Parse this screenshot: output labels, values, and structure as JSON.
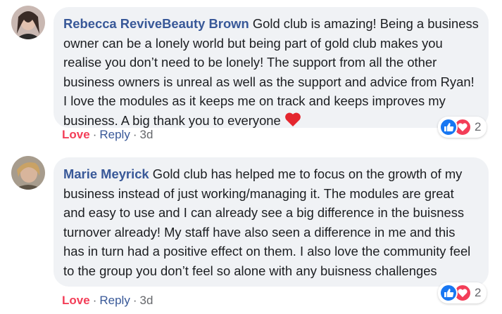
{
  "comments": [
    {
      "author": "Rebecca ReviveBeauty Brown",
      "text": "Gold club is amazing! Being a business owner can be a lonely world but being part of gold club makes you realise you don’t need to be lonely! The support from all the other business owners is unreal as well as the support and advice from Ryan! I love the modules as it keeps me on track and keeps improves my business. A big thank you to everyone",
      "reaction_count": "2",
      "reaction_label": "Love",
      "reply_label": "Reply",
      "time": "3d"
    },
    {
      "author": "Marie Meyrick",
      "text": "Gold club has helped me to focus on the growth of my business instead of just working/managing it. The modules are great and easy to use and I can already see a big difference in the buisness turnover already! My staff have also seen a difference in me and this has in turn had a positive effect on them. I also love the community feel to the group you don’t feel so alone with any buisness challenges",
      "reaction_count": "2",
      "reaction_label": "Love",
      "reply_label": "Reply",
      "time": "3d"
    }
  ],
  "colors": {
    "author": "#385898",
    "love": "#f33e58",
    "like": "#1877f2",
    "bubble": "#f0f2f5"
  },
  "icons": {
    "heart": "heart-icon",
    "like": "like-reaction-icon",
    "love": "love-reaction-icon"
  }
}
